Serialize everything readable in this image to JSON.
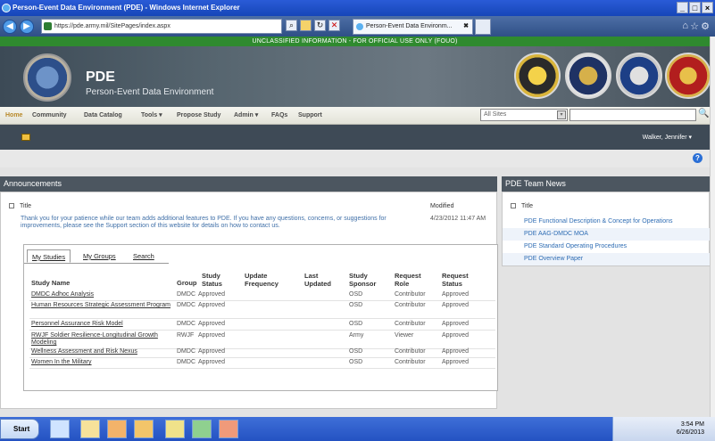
{
  "window": {
    "title": "Person-Event Data Environment (PDE) - Windows Internet Explorer"
  },
  "browser": {
    "url": "https://pde.army.mil/SitePages/index.aspx",
    "tab_title": "Person-Event Data Environm...",
    "tab_close": "✖",
    "back_icon": "◀",
    "forward_icon": "▶"
  },
  "classification": "UNCLASSIFIED INFORMATION - FOR OFFICIAL USE ONLY (FOUO)",
  "site": {
    "title": "PDE",
    "subtitle": "Person-Event Data Environment"
  },
  "nav": {
    "items": [
      "Home",
      "Community",
      "Data Catalog",
      "Tools ▾",
      "Propose Study",
      "Admin ▾",
      "FAQs",
      "Support"
    ],
    "scope": "All Sites",
    "dropdown_arrow": "▾",
    "search_icon": "🔍"
  },
  "ribbon": {
    "user": "Walker, Jennifer ▾"
  },
  "help": "?",
  "announcements": {
    "header": "Announcements",
    "col_title": "Title",
    "col_modified": "Modified",
    "text": "Thank you for your patience while our team adds additional features to PDE. If you have any questions, concerns, or suggestions for improvements, please see the Support section of this website for details on how to contact us.",
    "date": "4/23/2012 11:47 AM"
  },
  "news": {
    "header": "PDE Team News",
    "col_title": "Title",
    "items": [
      "PDE Functional Description & Concept for Operations",
      "PDE AAG-DMDC MOA",
      "PDE Standard Operating Procedures",
      "PDE Overview Paper"
    ]
  },
  "studies": {
    "tabs": [
      "My Studies",
      "My Groups",
      "Search"
    ],
    "columns": [
      "Study Name",
      "Group",
      "Study\nStatus",
      "Update\nFrequency",
      "Last\nUpdated",
      "Study\nSponsor",
      "Request\nRole",
      "Request\nStatus"
    ],
    "rows": [
      {
        "name": "DMDC Adhoc Analysis",
        "group": "DMDC",
        "status": "Approved",
        "freq": "",
        "updated": "",
        "sponsor": "OSD",
        "role": "Contributor",
        "req": "Approved"
      },
      {
        "name": "Human Resources Strategic Assessment Program",
        "group": "DMDC",
        "status": "Approved",
        "freq": "",
        "updated": "",
        "sponsor": "OSD",
        "role": "Contributor",
        "req": "Approved"
      },
      {
        "name": "Personnel Assurance Risk Model",
        "group": "DMDC",
        "status": "Approved",
        "freq": "",
        "updated": "",
        "sponsor": "OSD",
        "role": "Contributor",
        "req": "Approved"
      },
      {
        "name": "RWJF Soldier Resilience-Longitudinal Growth Modeling",
        "group": "RWJF",
        "status": "Approved",
        "freq": "",
        "updated": "",
        "sponsor": "Army",
        "role": "Viewer",
        "req": "Approved"
      },
      {
        "name": "Wellness Assessment and Risk Nexus",
        "group": "DMDC",
        "status": "Approved",
        "freq": "",
        "updated": "",
        "sponsor": "OSD",
        "role": "Contributor",
        "req": "Approved"
      },
      {
        "name": "Women In the Military",
        "group": "DMDC",
        "status": "Approved",
        "freq": "",
        "updated": "",
        "sponsor": "OSD",
        "role": "Contributor",
        "req": "Approved"
      }
    ]
  },
  "taskbar": {
    "start": "Start",
    "time": "3:54 PM",
    "date": "6/26/2013"
  },
  "colors": {
    "classification": "#2f8a2f",
    "panel_header": "#4c5660",
    "link": "#2f6db4"
  }
}
